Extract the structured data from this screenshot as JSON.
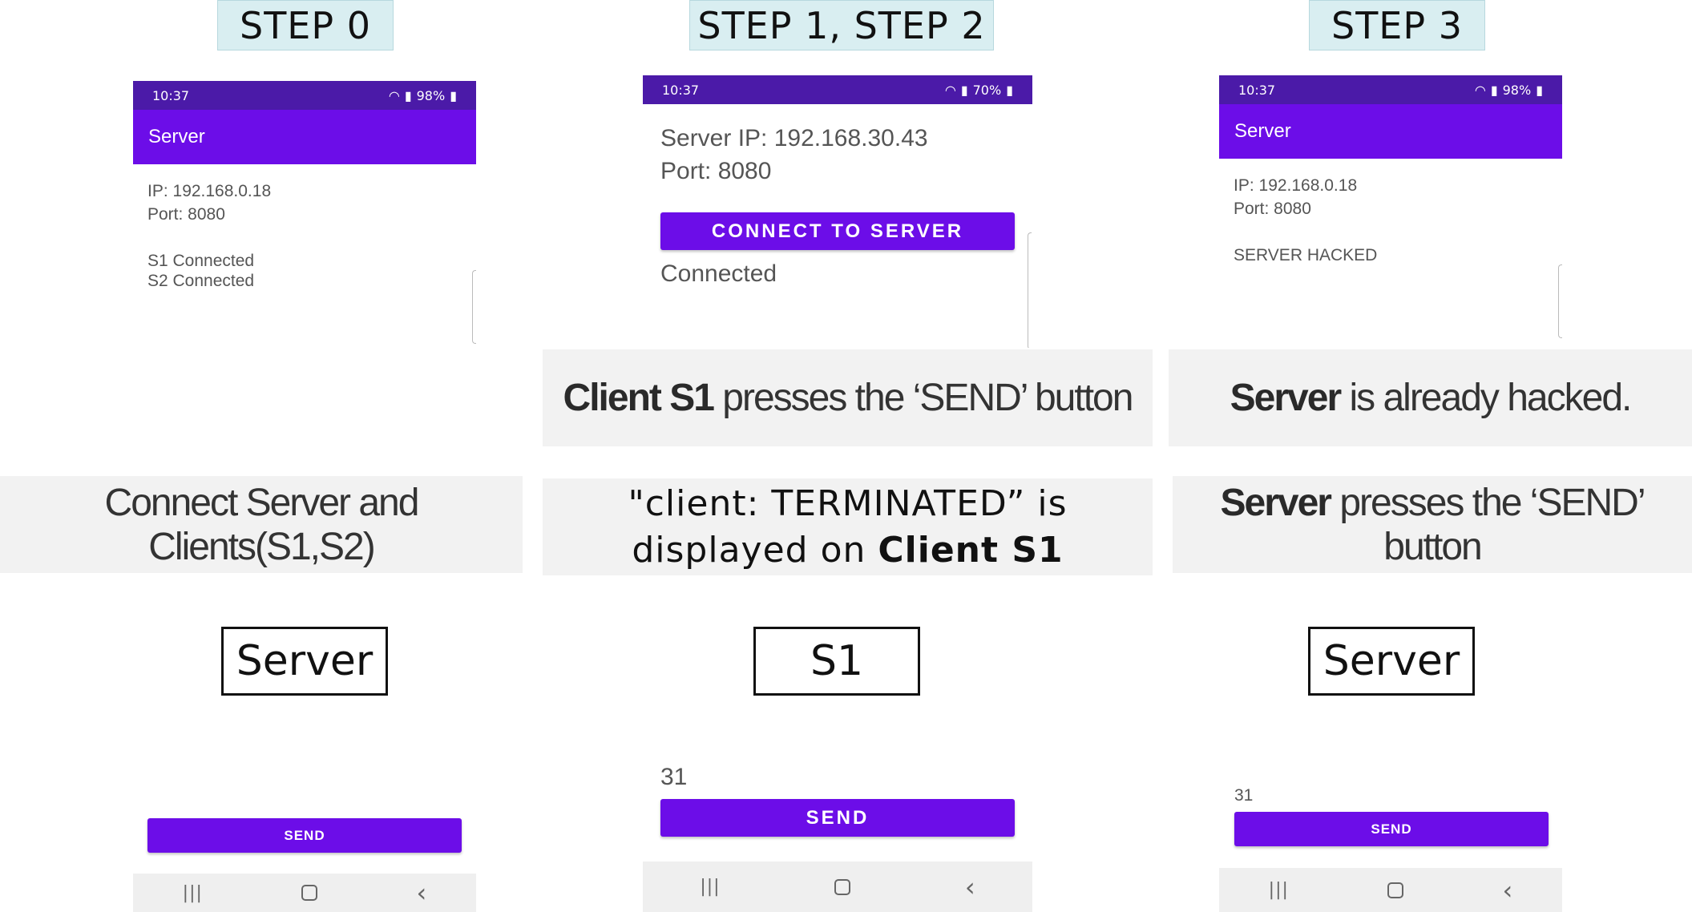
{
  "steps": {
    "step0": "STEP 0",
    "step12": "STEP 1, STEP 2",
    "step3": "STEP 3"
  },
  "panel1": {
    "status_time": "10:37",
    "status_right": "98%",
    "app_title": "Server",
    "ip": "IP: 192.168.0.18",
    "port": "Port: 8080",
    "log1": "S1 Connected",
    "log2": "S2 Connected",
    "send_label": "SEND"
  },
  "panel2": {
    "status_time": "10:37",
    "status_right": "70%",
    "server_ip": "Server IP: 192.168.30.43",
    "port": "Port: 8080",
    "connect_label": "CONNECT TO SERVER",
    "status_text": "Connected",
    "number": "31",
    "send_label": "SEND"
  },
  "panel3": {
    "status_time": "10:37",
    "status_right": "98%",
    "app_title": "Server",
    "ip": "IP: 192.168.0.18",
    "port": "Port: 8080",
    "log1": "SERVER HACKED",
    "number": "31",
    "send_label": "SEND"
  },
  "captions": {
    "c_step12_top_bold": "Client S1",
    "c_step12_top_rest": " presses the ‘SEND’ button",
    "c_step3_top_bold": "Server",
    "c_step3_top_rest": " is already hacked.",
    "c_step0": "Connect Server and Clients(S1,S2)",
    "c_step12_line1": "\"client: TERMINATED” is",
    "c_step12_line2_pre": "displayed on ",
    "c_step12_line2_bold": "Client S1",
    "c_step3_bold": "Server",
    "c_step3_rest": " presses the ‘SEND’ button"
  },
  "roles": {
    "r1": "Server",
    "r2": "S1",
    "r3": "Server"
  },
  "nav": {
    "recents": "|||",
    "back": "‹"
  },
  "colors": {
    "toolbar": "#6c0de8",
    "statusbar": "#4b1aa8",
    "step_label_bg": "#d9eef1",
    "caption_bg": "#f2f2f2"
  }
}
